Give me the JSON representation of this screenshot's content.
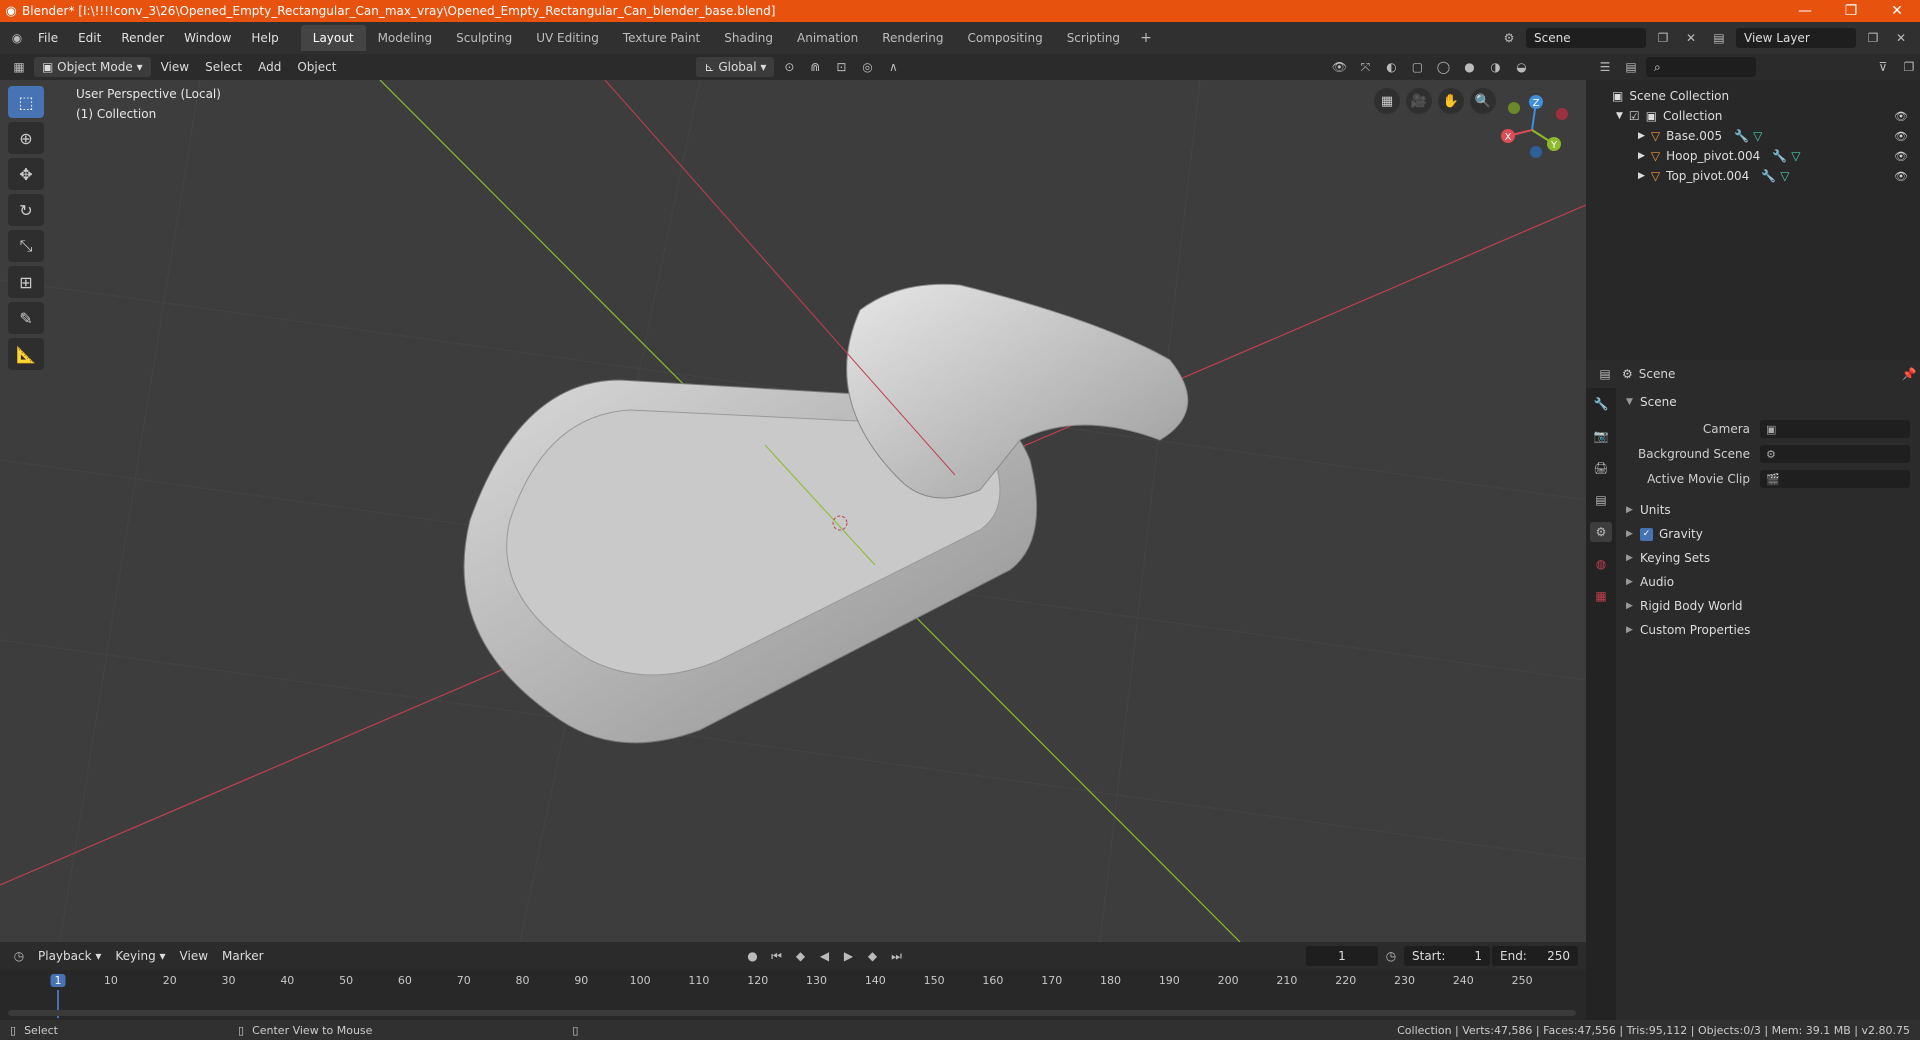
{
  "window": {
    "title": "Blender* [I:\\!!!!conv_3\\26\\Opened_Empty_Rectangular_Can_max_vray\\Opened_Empty_Rectangular_Can_blender_base.blend]",
    "minimize": "—",
    "maximize": "❐",
    "close": "✕"
  },
  "menu": [
    "File",
    "Edit",
    "Render",
    "Window",
    "Help"
  ],
  "workspaces": [
    "Layout",
    "Modeling",
    "Sculpting",
    "UV Editing",
    "Texture Paint",
    "Shading",
    "Animation",
    "Rendering",
    "Compositing",
    "Scripting"
  ],
  "active_workspace": "Layout",
  "scene_field": "Scene",
  "view_layer_field": "View Layer",
  "viewport": {
    "mode": "Object Mode",
    "menus": [
      "View",
      "Select",
      "Add",
      "Object"
    ],
    "orientation": "Global",
    "info_line1": "User Perspective (Local)",
    "info_line2": "(1) Collection",
    "gizmo": {
      "x": "X",
      "y": "Y",
      "z": "Z"
    }
  },
  "outliner": {
    "root": "Scene Collection",
    "collection": "Collection",
    "objects": [
      "Base.005",
      "Hoop_pivot.004",
      "Top_pivot.004"
    ]
  },
  "properties": {
    "header": "Scene",
    "panel": "Scene",
    "fields": [
      {
        "label": "Camera",
        "value": ""
      },
      {
        "label": "Background Scene",
        "value": ""
      },
      {
        "label": "Active Movie Clip",
        "value": ""
      }
    ],
    "sections": [
      "Units",
      "Gravity",
      "Keying Sets",
      "Audio",
      "Rigid Body World",
      "Custom Properties"
    ],
    "gravity_checked": true
  },
  "timeline": {
    "menus": [
      "Playback",
      "Keying",
      "View",
      "Marker"
    ],
    "current_frame": "1",
    "start_label": "Start:",
    "start": "1",
    "end_label": "End:",
    "end": "250",
    "ticks": [
      "1",
      "10",
      "20",
      "30",
      "40",
      "50",
      "60",
      "70",
      "80",
      "90",
      "100",
      "110",
      "120",
      "130",
      "140",
      "150",
      "160",
      "170",
      "180",
      "190",
      "200",
      "210",
      "220",
      "230",
      "240",
      "250"
    ]
  },
  "statusbar": {
    "left": "Select",
    "middle": "Center View to Mouse",
    "right": "Collection | Verts:47,586 | Faces:47,556 | Tris:95,112 | Objects:0/3 | Mem: 39.1 MB | v2.80.75"
  },
  "colors": {
    "title_bar": "#e8520f",
    "accent": "#4772b3",
    "x_axis": "#e04a55",
    "y_axis": "#8bbb2a",
    "z_axis": "#3f8ee0"
  }
}
